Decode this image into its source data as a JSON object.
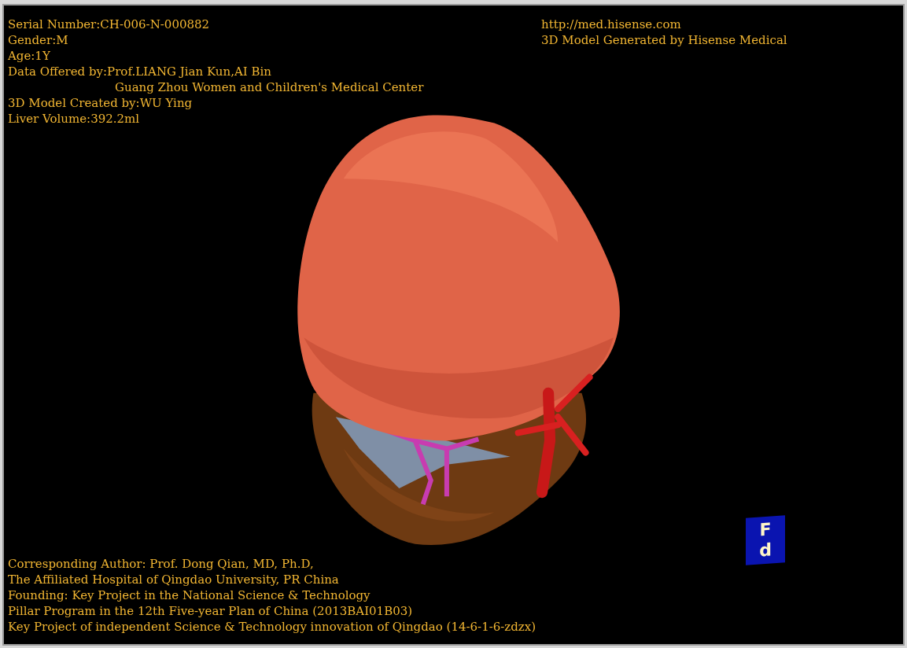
{
  "info_left": [
    {
      "text": "Serial Number:CH-006-N-000882",
      "kind": "line"
    },
    {
      "text": "Gender:M",
      "kind": "line"
    },
    {
      "text": "Age:1Y",
      "kind": "line"
    },
    {
      "text": "Data Offered by:Prof.LIANG Jian Kun,AI Bin",
      "kind": "line"
    },
    {
      "text": "Guang Zhou Women and Children's Medical Center",
      "kind": "continuation"
    },
    {
      "text": "3D Model Created by:WU Ying",
      "kind": "line"
    },
    {
      "text": "Liver Volume:392.2ml",
      "kind": "line"
    }
  ],
  "info_right": [
    {
      "text": "http://med.hisense.com",
      "kind": "line"
    },
    {
      "text": "3D Model Generated by Hisense Medical",
      "kind": "line"
    }
  ],
  "credits": [
    {
      "text": "Corresponding Author: Prof. Dong Qian, MD, Ph.D,",
      "kind": "line"
    },
    {
      "text": "The Affiliated Hospital of Qingdao University, PR China",
      "kind": "line"
    },
    {
      "text": "Founding: Key Project in the National Science & Technology",
      "kind": "line"
    },
    {
      "text": "Pillar Program in the 12th Five-year Plan of China (2013BAI01B03)",
      "kind": "line"
    },
    {
      "text": "Key Project of independent Science & Technology innovation of Qingdao (14-6-1-6-zdzx)",
      "kind": "line"
    }
  ],
  "orientation_cube": {
    "labels": [
      "F",
      "d"
    ]
  }
}
